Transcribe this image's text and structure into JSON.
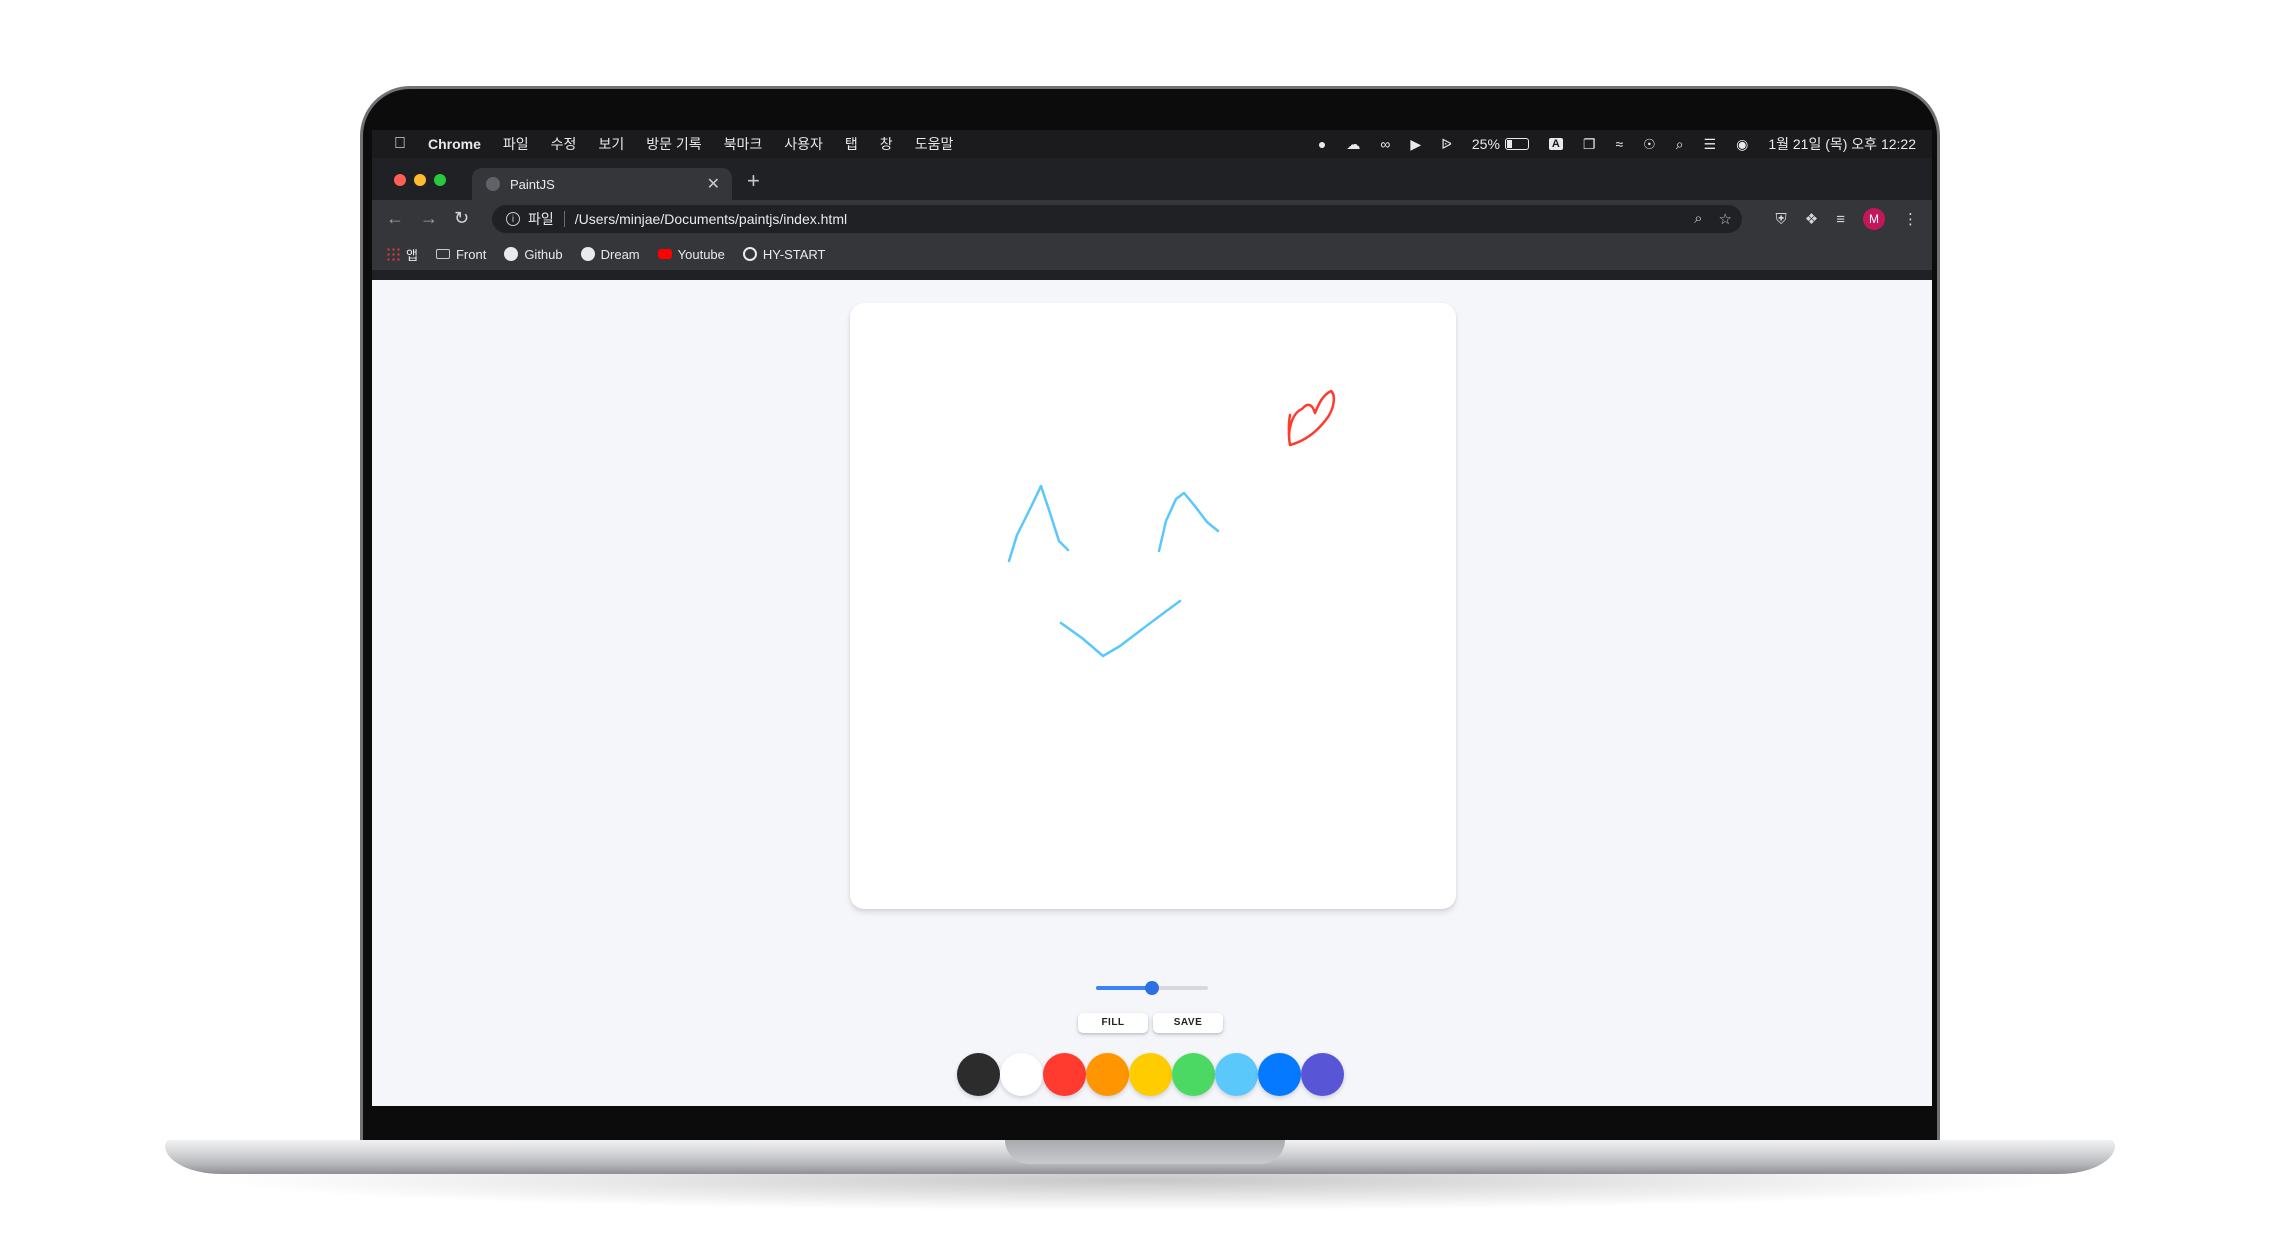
{
  "mac_menubar": {
    "app_name": "Chrome",
    "menus": [
      "파일",
      "수정",
      "보기",
      "방문 기록",
      "북마크",
      "사용자",
      "탭",
      "창",
      "도움말"
    ],
    "battery": "25%",
    "input_source": "A",
    "datetime": "1월 21일 (목) 오후 12:22"
  },
  "browser": {
    "tab_title": "PaintJS",
    "url_scheme_label": "파일",
    "url": "/Users/minjae/Documents/paintjs/index.html",
    "profile_initial": "M",
    "bookmarks": [
      {
        "label": "앱",
        "icon": "apps-grid-icon"
      },
      {
        "label": "Front",
        "icon": "folder-icon"
      },
      {
        "label": "Github",
        "icon": "github-icon"
      },
      {
        "label": "Dream",
        "icon": "dream-icon"
      },
      {
        "label": "Youtube",
        "icon": "youtube-icon"
      },
      {
        "label": "HY-START",
        "icon": "globe-icon"
      }
    ]
  },
  "paint": {
    "brush_size": 0.5,
    "buttons": {
      "fill": "FILL",
      "save": "SAVE"
    },
    "palette": [
      "#2c2c2c",
      "#ffffff",
      "#ff3b30",
      "#ff9500",
      "#ffcc00",
      "#4cd963",
      "#5ac8fa",
      "#0579ff",
      "#5856d6"
    ],
    "stroke_colors": {
      "face": "#5ac8fa",
      "heart": "#ff3b30"
    }
  }
}
